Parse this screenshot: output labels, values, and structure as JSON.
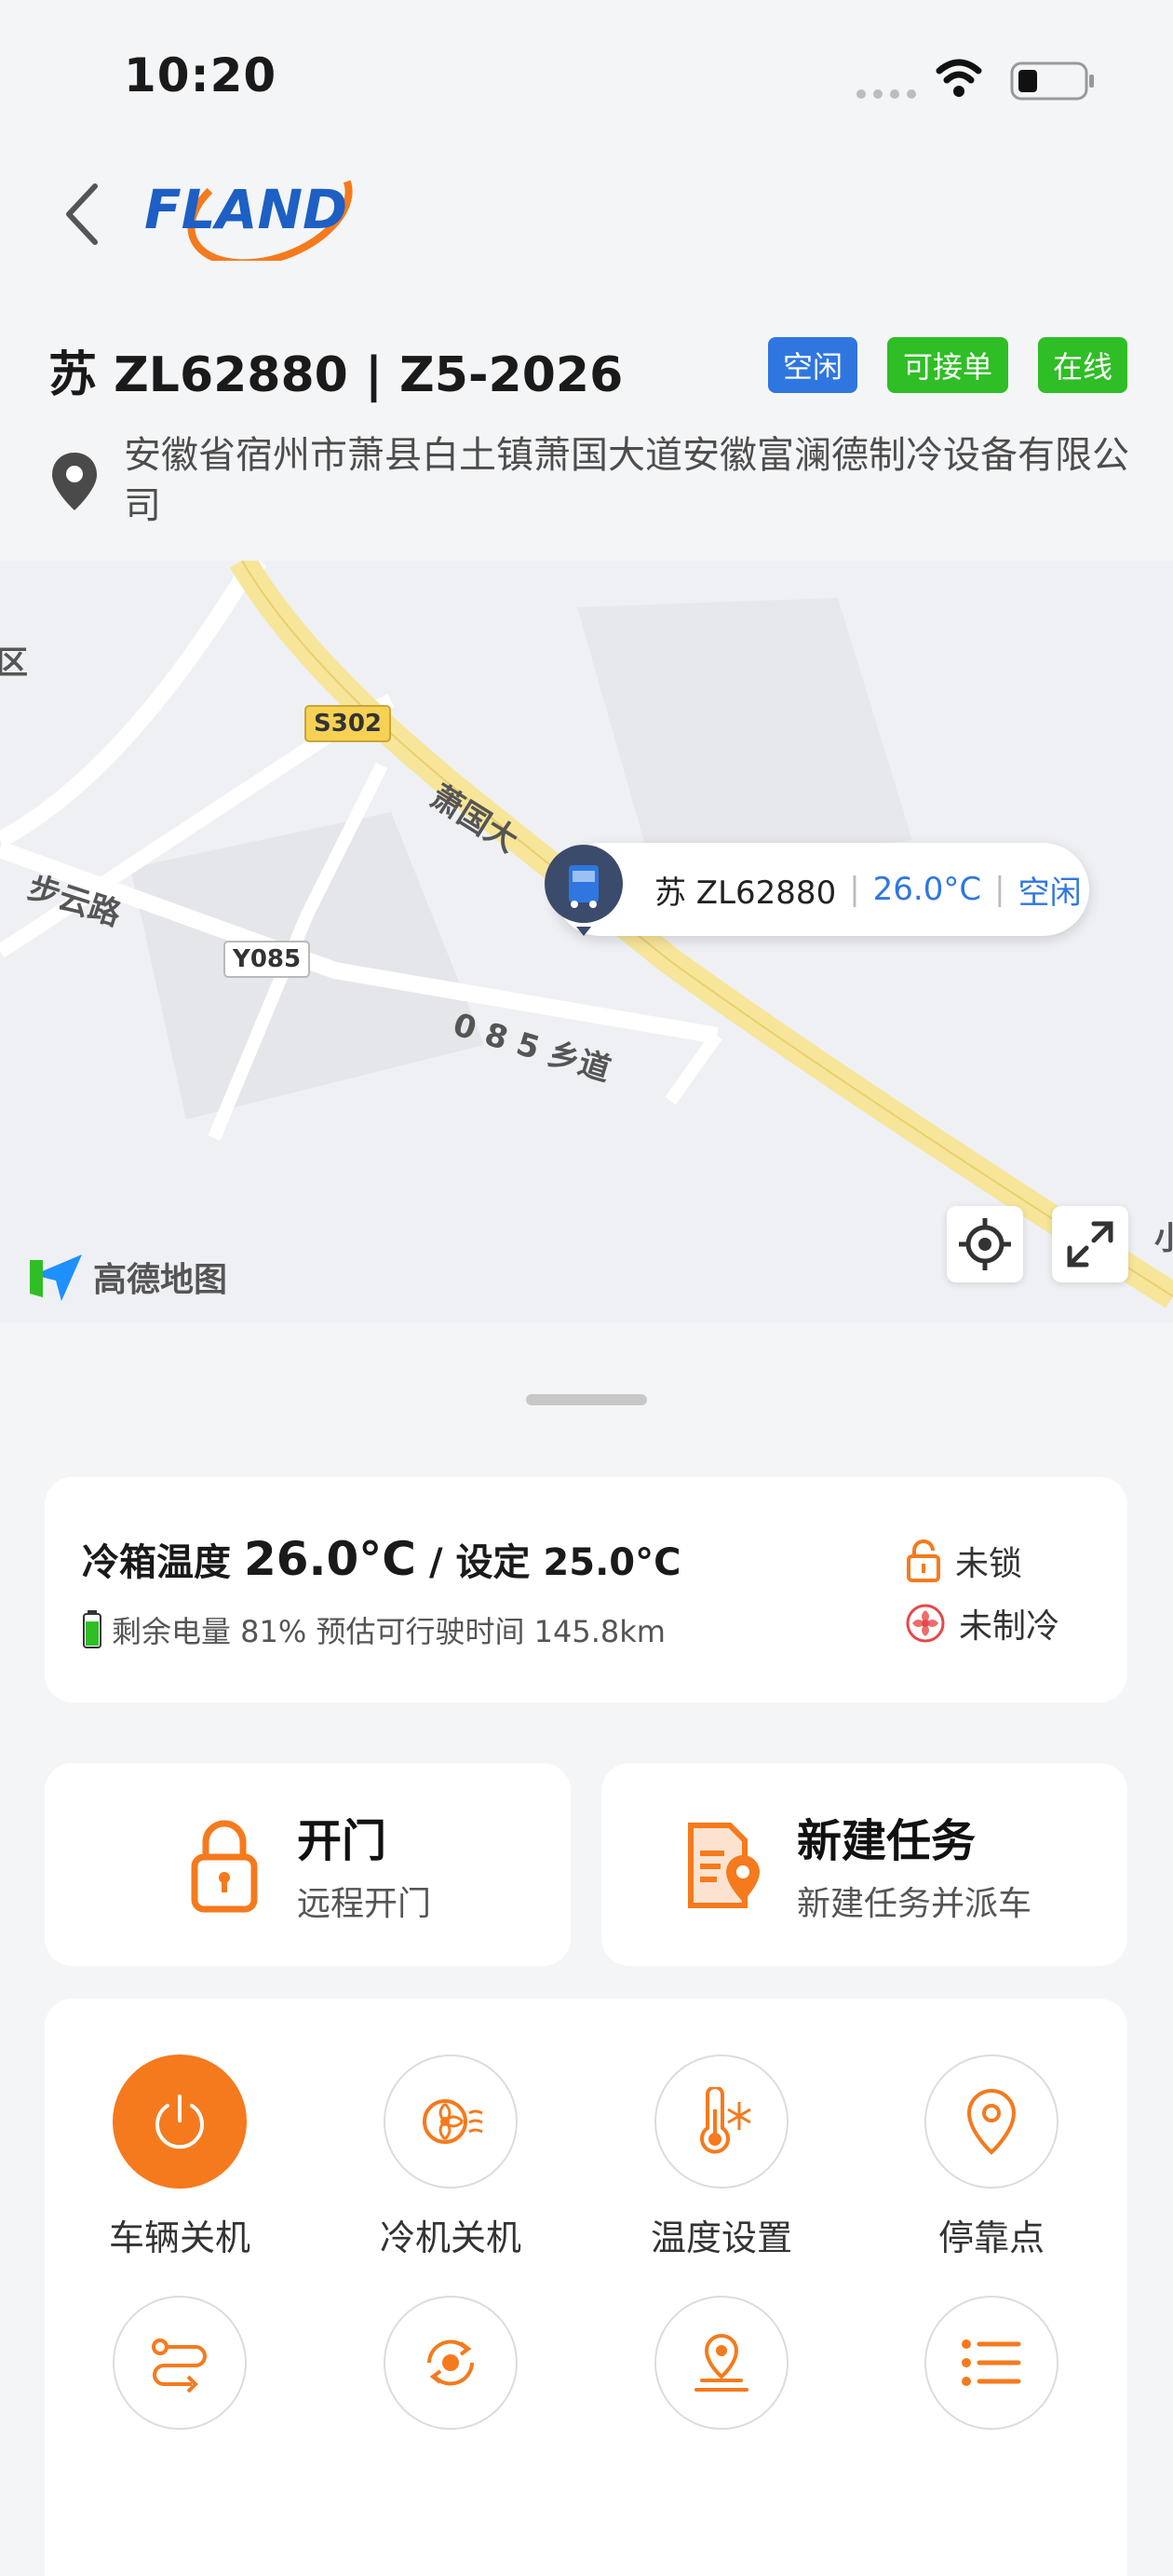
{
  "status_bar": {
    "time": "10:20"
  },
  "header": {
    "logo_text": "FLAND"
  },
  "vehicle": {
    "title": "苏 ZL62880 | Z5-2026",
    "badges": {
      "idle": "空闲",
      "accept": "可接单",
      "online": "在线"
    },
    "address": "安徽省宿州市萧县白土镇萧国大道安徽富澜德制冷设备有限公司"
  },
  "map": {
    "labels": {
      "road_s302": "S302",
      "road_y085": "Y085",
      "xiaoguo": "萧国大",
      "buyun": "步云路",
      "xiangdao": "0 8 5 乡道",
      "edge_left": "区",
      "edge_right": "小"
    },
    "bubble": {
      "plate": "苏 ZL62880",
      "temp": "26.0°C",
      "status": "空闲"
    },
    "provider": "高德地图"
  },
  "info": {
    "temp_prefix": "冷箱温度",
    "temp_value": "26.0°C",
    "set_prefix": "/ 设定",
    "set_value": "25.0°C",
    "battery": "剩余电量 81% 预估可行驶时间 145.8km",
    "battery_level": 0.81,
    "lock_status": "未锁",
    "cool_status": "未制冷"
  },
  "actions": {
    "door": {
      "title": "开门",
      "sub": "远程开门"
    },
    "task": {
      "title": "新建任务",
      "sub": "新建任务并派车"
    }
  },
  "functions": [
    {
      "label": "车辆关机",
      "icon": "power-icon"
    },
    {
      "label": "冷机关机",
      "icon": "fan-icon"
    },
    {
      "label": "温度设置",
      "icon": "thermometer-snow-icon"
    },
    {
      "label": "停靠点",
      "icon": "location-pin-icon"
    },
    {
      "label": "",
      "icon": "route-icon"
    },
    {
      "label": "",
      "icon": "cycle-icon"
    },
    {
      "label": "",
      "icon": "map-pin-icon"
    },
    {
      "label": "",
      "icon": "list-icon"
    }
  ],
  "colors": {
    "accent": "#f57a1d",
    "blue": "#2f76e0",
    "green": "#2fbe25"
  }
}
